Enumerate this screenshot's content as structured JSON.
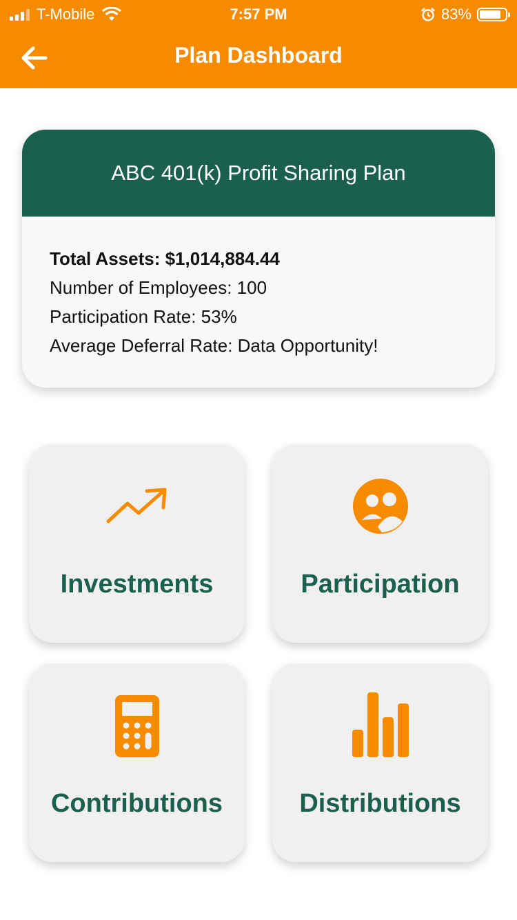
{
  "status_bar": {
    "carrier": "T-Mobile",
    "time": "7:57 PM",
    "battery_percent": "83%",
    "battery_level": 0.83
  },
  "header": {
    "title": "Plan Dashboard",
    "back_icon": "arrow-left-icon",
    "color": "#f78b00"
  },
  "plan_card": {
    "plan_name": "ABC 401(k) Profit Sharing Plan",
    "total_assets": "Total Assets: $1,014,884.44",
    "employees": "Number of Employees: 100",
    "participation_rate": "Participation Rate: 53%",
    "deferral_rate": "Average Deferral Rate: Data Opportunity!",
    "header_color": "#1b604e"
  },
  "tiles": [
    {
      "label": "Investments",
      "icon": "trending-up-icon"
    },
    {
      "label": "Participation",
      "icon": "group-icon"
    },
    {
      "label": "Contributions",
      "icon": "calculator-icon"
    },
    {
      "label": "Distributions",
      "icon": "bar-chart-icon"
    }
  ]
}
